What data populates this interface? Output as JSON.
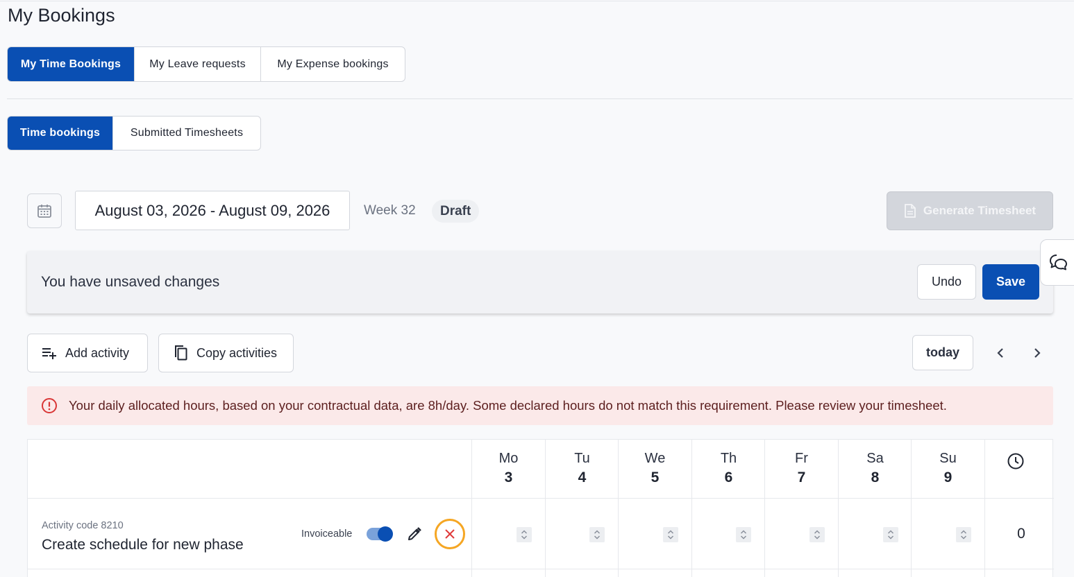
{
  "page": {
    "title": "My Bookings"
  },
  "main_tabs": [
    {
      "label": "My Time Bookings",
      "active": true
    },
    {
      "label": "My Leave requests",
      "active": false
    },
    {
      "label": "My Expense bookings",
      "active": false
    }
  ],
  "sub_tabs": [
    {
      "label": "Time bookings",
      "active": true
    },
    {
      "label": "Submitted Timesheets",
      "active": false
    }
  ],
  "period": {
    "date_range": "August 03, 2026 - August 09, 2026",
    "week": "Week 32",
    "status": "Draft",
    "generate_label": "Generate Timesheet"
  },
  "unsaved": {
    "message": "You have unsaved changes",
    "undo_label": "Undo",
    "save_label": "Save"
  },
  "actions": {
    "add_activity": "Add activity",
    "copy_activities": "Copy activities",
    "today": "today"
  },
  "alert": {
    "message": "Your daily allocated hours, based on your contractual data, are 8h/day. Some declared hours do not match this requirement. Please review your timesheet."
  },
  "days": [
    {
      "name": "Mo",
      "num": "3"
    },
    {
      "name": "Tu",
      "num": "4"
    },
    {
      "name": "We",
      "num": "5"
    },
    {
      "name": "Th",
      "num": "6"
    },
    {
      "name": "Fr",
      "num": "7"
    },
    {
      "name": "Sa",
      "num": "8"
    },
    {
      "name": "Su",
      "num": "9"
    }
  ],
  "rows": [
    {
      "code": "Activity code 8210",
      "name": "Create schedule for new phase",
      "invoiceable_label": "Invoiceable",
      "invoiceable": true,
      "total": "0"
    }
  ],
  "colors": {
    "primary": "#0a4fb3",
    "alert_bg": "#fbe9e9",
    "alert_icon": "#d93636",
    "highlight": "#f5a623"
  }
}
